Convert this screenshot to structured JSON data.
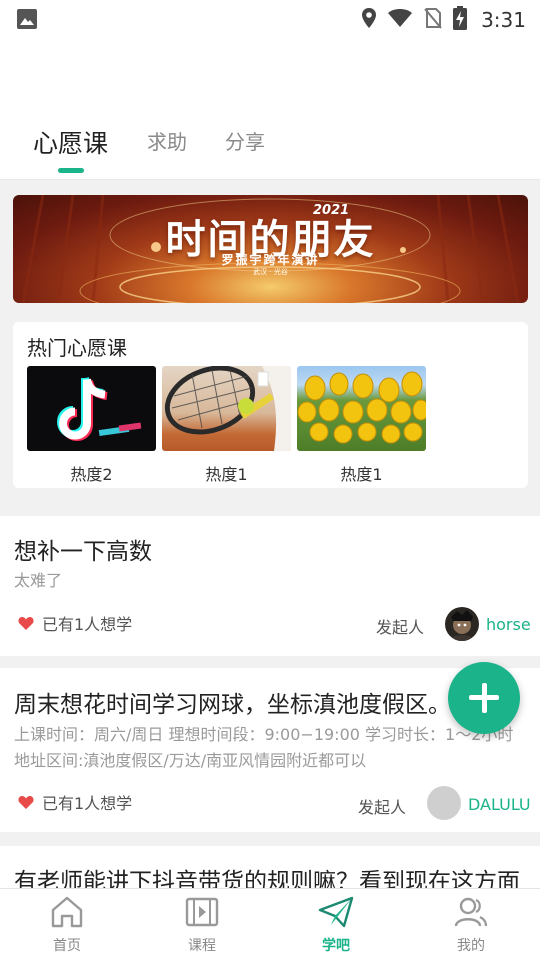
{
  "status_bar": {
    "time": "3:31",
    "icons": [
      "image-icon",
      "location-icon",
      "wifi-icon",
      "no-sim-icon",
      "battery-charging-icon"
    ]
  },
  "tabs": [
    {
      "label": "心愿课",
      "active": true
    },
    {
      "label": "求助",
      "active": false
    },
    {
      "label": "分享",
      "active": false
    }
  ],
  "banner": {
    "title": "时间的朋友",
    "year": "2021",
    "subtitle": "罗振宇跨年演讲",
    "small_text": "武汉 · 光谷"
  },
  "hot": {
    "title": "热门心愿课",
    "items": [
      {
        "label": "热度2",
        "image": "tiktok-logo"
      },
      {
        "label": "热度1",
        "image": "tennis-racket-photo"
      },
      {
        "label": "热度1",
        "image": "tulips-photo"
      }
    ]
  },
  "posts": [
    {
      "title": "想补一下高数",
      "desc": "太难了",
      "want": "已有1人想学",
      "initiator_label": "发起人",
      "user": "horse"
    },
    {
      "title": "周末想花时间学习网球，坐标滇池度假区。",
      "desc": "上课时间：周六/周日 理想时间段：9:00−19:00 学习时长：1〜2小时",
      "desc2": "地址区间:滇池度假区/万达/南亚风情园附近都可以",
      "want": "已有1人想学",
      "initiator_label": "发起人",
      "user": "DALULU"
    },
    {
      "title": "有老师能讲下抖音带货的规则嘛？看到现在这方面"
    }
  ],
  "fab": {
    "icon": "plus-icon"
  },
  "bottom_nav": [
    {
      "label": "首页",
      "icon": "home-icon",
      "active": false
    },
    {
      "label": "课程",
      "icon": "video-course-icon",
      "active": false
    },
    {
      "label": "学吧",
      "icon": "paper-plane-icon",
      "active": true
    },
    {
      "label": "我的",
      "icon": "profile-icon",
      "active": false
    }
  ],
  "colors": {
    "accent": "#1bb38a",
    "heart": "#e84a4a"
  }
}
